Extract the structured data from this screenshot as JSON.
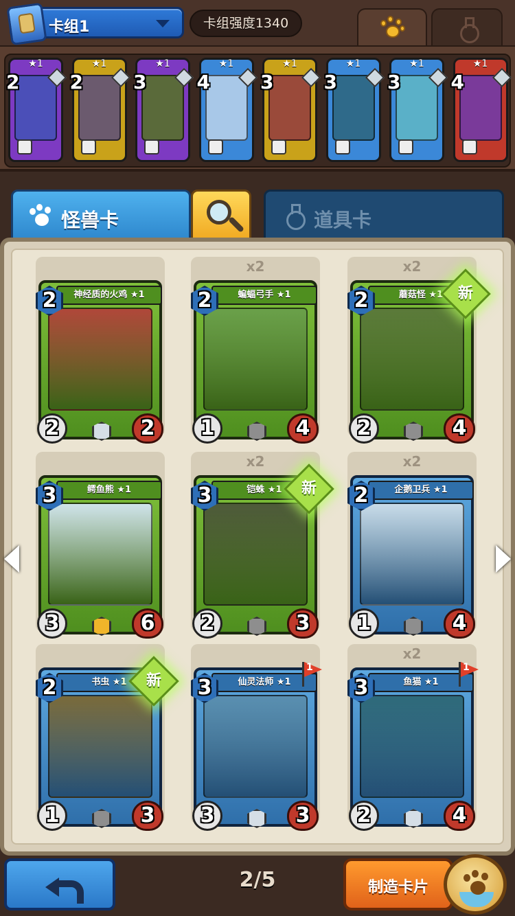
{
  "header": {
    "deck_name": "卡组1",
    "deck_power": "卡组强度1340"
  },
  "deck_strip": [
    {
      "cost": "2",
      "stars": "★1",
      "bg": "#7d3ac2",
      "art": "#4b4fb8"
    },
    {
      "cost": "2",
      "stars": "★1",
      "bg": "#c9a21a",
      "art": "#6b5a6e"
    },
    {
      "cost": "3",
      "stars": "★1",
      "bg": "#7d3ac2",
      "art": "#5a6a3a"
    },
    {
      "cost": "4",
      "stars": "★1",
      "bg": "#3b88d8",
      "art": "#a8c8e8"
    },
    {
      "cost": "3",
      "stars": "★1",
      "bg": "#c9a21a",
      "art": "#9a4a3a"
    },
    {
      "cost": "3",
      "stars": "★1",
      "bg": "#3b88d8",
      "art": "#2f6a8a"
    },
    {
      "cost": "3",
      "stars": "★1",
      "bg": "#3b88d8",
      "art": "#5ab0c8"
    },
    {
      "cost": "4",
      "stars": "★1",
      "bg": "#c0392b",
      "art": "#7a3a9a"
    }
  ],
  "tabs": {
    "monster_label": "怪兽卡",
    "item_label": "道具卡"
  },
  "cards": [
    {
      "name": "神经质的火鸡 ★1",
      "cost": "2",
      "atk": "2",
      "hp": "2",
      "qty": "",
      "new": false,
      "flag": "",
      "frame": "green",
      "rarity": "silver",
      "art": "#b0473a"
    },
    {
      "name": "蝙蝠弓手 ★1",
      "cost": "2",
      "atk": "1",
      "hp": "4",
      "qty": "x2",
      "new": false,
      "flag": "",
      "frame": "green",
      "rarity": "gray",
      "art": "#6aa04a"
    },
    {
      "name": "蘑菇怪 ★1",
      "cost": "2",
      "atk": "2",
      "hp": "4",
      "qty": "x2",
      "new": true,
      "flag": "",
      "frame": "green",
      "rarity": "gray",
      "art": "#5b7a3a"
    },
    {
      "name": "鳄鱼熊 ★1",
      "cost": "3",
      "atk": "3",
      "hp": "6",
      "qty": "",
      "new": false,
      "flag": "",
      "frame": "green",
      "rarity": "gold",
      "art": "#cfe3ea"
    },
    {
      "name": "铠蛛 ★1",
      "cost": "3",
      "atk": "2",
      "hp": "3",
      "qty": "x2",
      "new": true,
      "flag": "",
      "frame": "green",
      "rarity": "gray",
      "art": "#4e5a3a"
    },
    {
      "name": "企鹅卫兵 ★1",
      "cost": "2",
      "atk": "1",
      "hp": "4",
      "qty": "x2",
      "new": false,
      "flag": "",
      "frame": "blue",
      "rarity": "gray",
      "art": "#c8dbe8"
    },
    {
      "name": "书虫 ★1",
      "cost": "2",
      "atk": "1",
      "hp": "3",
      "qty": "",
      "new": true,
      "flag": "",
      "frame": "blue",
      "rarity": "gray",
      "art": "#7a6a3a"
    },
    {
      "name": "仙灵法师 ★1",
      "cost": "3",
      "atk": "3",
      "hp": "3",
      "qty": "",
      "new": false,
      "flag": "1",
      "frame": "blue",
      "rarity": "silver",
      "art": "#5a8fb0"
    },
    {
      "name": "鱼猫 ★1",
      "cost": "3",
      "atk": "2",
      "hp": "4",
      "qty": "x2",
      "new": false,
      "flag": "1",
      "frame": "blue",
      "rarity": "silver",
      "art": "#2f6a7a"
    }
  ],
  "new_badge": "新",
  "pager": {
    "label": "2/5"
  },
  "footer": {
    "craft_label": "制造卡片"
  }
}
